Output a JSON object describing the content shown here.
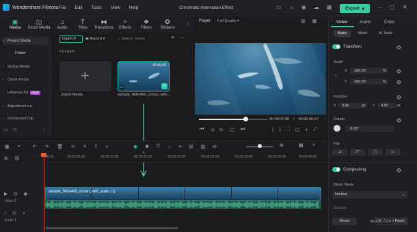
{
  "app": {
    "name": "Wondershare Filmora",
    "menu": [
      "File",
      "Edit",
      "Tools",
      "View",
      "Help"
    ],
    "document_title": "Chromatic Aberration Effect",
    "export_label": "Export"
  },
  "media_tabs": [
    {
      "label": "Media",
      "icon": "folder-icon",
      "active": true
    },
    {
      "label": "Stock Media",
      "icon": "stock-icon",
      "active": false
    },
    {
      "label": "Audio",
      "icon": "music-note-icon",
      "active": false
    },
    {
      "label": "Titles",
      "icon": "text-icon",
      "active": false
    },
    {
      "label": "Transitions",
      "icon": "transition-icon",
      "active": false
    },
    {
      "label": "Effects",
      "icon": "effects-icon",
      "active": false
    },
    {
      "label": "Filters",
      "icon": "filter-icon",
      "active": false
    },
    {
      "label": "Stickers",
      "icon": "sticker-icon",
      "active": false
    }
  ],
  "sidebar": {
    "items": [
      {
        "label": "Project Media",
        "selected": true
      },
      {
        "label": "Folder",
        "selected": false
      },
      {
        "label": "Global Media",
        "selected": false
      },
      {
        "label": "Cloud Media",
        "selected": false
      },
      {
        "label": "Influence Kit",
        "badge": "NEW",
        "selected": false
      },
      {
        "label": "Adjustment La...",
        "selected": false
      },
      {
        "label": "Compound Clip",
        "selected": false
      }
    ]
  },
  "browser": {
    "import_label": "Import",
    "record_label": "Record",
    "search_placeholder": "Search media",
    "folder_heading": "FOLDER",
    "import_tile_caption": "Import Media",
    "clip_caption": "sample_960x400_ocean_with...",
    "clip_duration": "00:00:46"
  },
  "player": {
    "label": "Player",
    "quality": "Full Quality",
    "current_time": "00:00:07:05",
    "total_time": "00:00:46:17",
    "progress": 0.68
  },
  "properties": {
    "tabs": [
      "Video",
      "Audio",
      "Color"
    ],
    "subtabs": [
      "Basic",
      "Mask",
      "AI Tools"
    ],
    "transform_label": "Transform",
    "scale_label": "Scale",
    "scale_x": "100.00",
    "scale_y": "100.00",
    "scale_unit": "%",
    "position_label": "Position",
    "pos_x": "0.00",
    "pos_y": "0.00",
    "pos_unit": "px",
    "rotate_label": "Rotate",
    "rotate_value": "0.00°",
    "flip_label": "Flip",
    "compositing_label": "Compositing",
    "blend_mode_label": "Blend Mode",
    "blend_mode_value": "Normal",
    "opacity_label": "Opacity",
    "reset_label": "Reset",
    "keyframe_label": "Keyframe Panel"
  },
  "timeline": {
    "ruler_ticks": [
      "00:00",
      "00:00:05:00",
      "00:00:10:00",
      "00:00:15:00",
      "00:00:20:00",
      "00:00:25:00",
      "00:00:30:00",
      "00:00:35:00",
      "00:00:40:00"
    ],
    "video_track_label": "Video 1",
    "audio_track_label": "Audio 1",
    "clip_label": "sample_960x400_ocean_with_audio (1)"
  },
  "watermark": "wsxdn.com"
}
